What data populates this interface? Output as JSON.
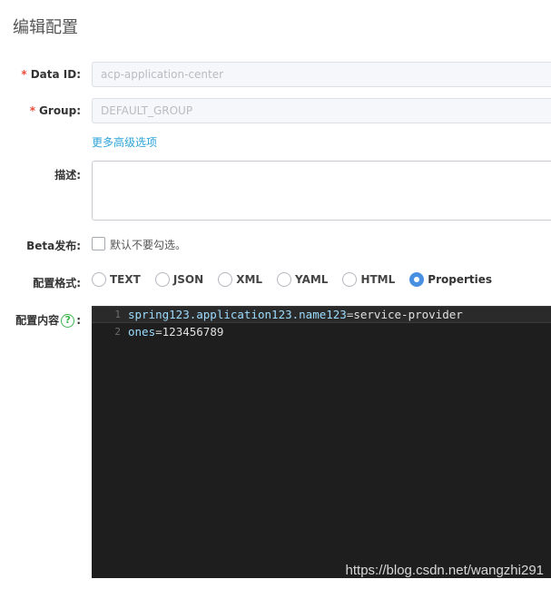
{
  "page": {
    "title": "编辑配置"
  },
  "form": {
    "data_id": {
      "label": "Data ID:",
      "value": "acp-application-center",
      "required": true
    },
    "group": {
      "label": "Group:",
      "value": "DEFAULT_GROUP",
      "required": true
    },
    "advanced_link": "更多高级选项",
    "description": {
      "label": "描述:",
      "value": ""
    },
    "beta": {
      "label": "Beta发布:",
      "checkbox_text": "默认不要勾选。",
      "checked": false
    },
    "format": {
      "label": "配置格式:",
      "options": [
        "TEXT",
        "JSON",
        "XML",
        "YAML",
        "HTML",
        "Properties"
      ],
      "selected": "Properties"
    },
    "content": {
      "label": "配置内容",
      "help_icon": "question-circle-icon",
      "label_suffix": ":",
      "lines": [
        {
          "number": "1",
          "key": "spring123.application123.name123",
          "eq": "=",
          "value": "service-provider"
        },
        {
          "number": "2",
          "key": "ones",
          "eq": "=",
          "value": "123456789"
        }
      ]
    }
  },
  "required_mark": "*",
  "watermark": "https://blog.csdn.net/wangzhi291",
  "colors": {
    "required": "#e74c3c",
    "link": "#2fa4d8",
    "radio_selected": "#4a90e2",
    "editor_bg": "#1e1e1e",
    "help_icon": "#3bb54a"
  }
}
